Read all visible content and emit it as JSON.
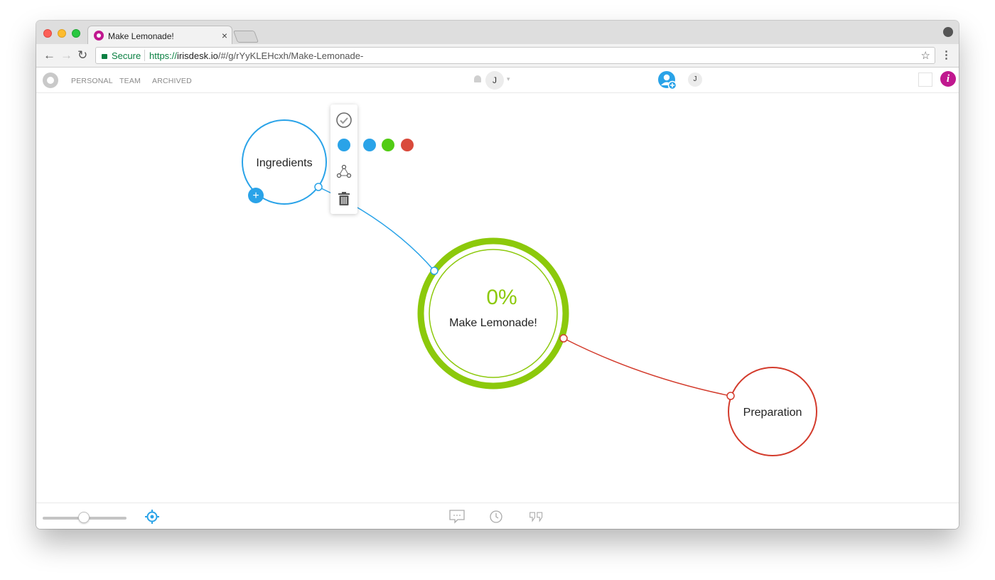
{
  "browser": {
    "tab_title": "Make Lemonade!",
    "tab_close": "×",
    "secure_label": "Secure",
    "url_scheme": "https://",
    "url_host": "irisdesk.io",
    "url_path": "/#/g/rYyKLEHcxh/Make-Lemonade-"
  },
  "app": {
    "nav": [
      "PERSONAL",
      "TEAM",
      "ARCHIVED"
    ],
    "user_initial": "J",
    "member_initial": "J",
    "info_label": "i"
  },
  "map": {
    "root": {
      "label": "Make Lemonade!",
      "progress": "0%",
      "color": "#8cc90b"
    },
    "children": [
      {
        "label": "Ingredients",
        "color": "#2aa3e8"
      },
      {
        "label": "Preparation",
        "color": "#d33b2c"
      }
    ],
    "add_child_label": "+"
  },
  "popover": {
    "icons": [
      "check-circle-icon",
      "color-dot-icon",
      "connect-nodes-icon",
      "trash-icon"
    ],
    "current_color": "#2aa3e8",
    "color_options": [
      "#2aa3e8",
      "#52cc14",
      "#d94a3b"
    ]
  },
  "bottom": {
    "zoom_level": 0.5,
    "icons": [
      "locate-icon",
      "comment-icon",
      "history-icon",
      "quote-icon"
    ]
  }
}
